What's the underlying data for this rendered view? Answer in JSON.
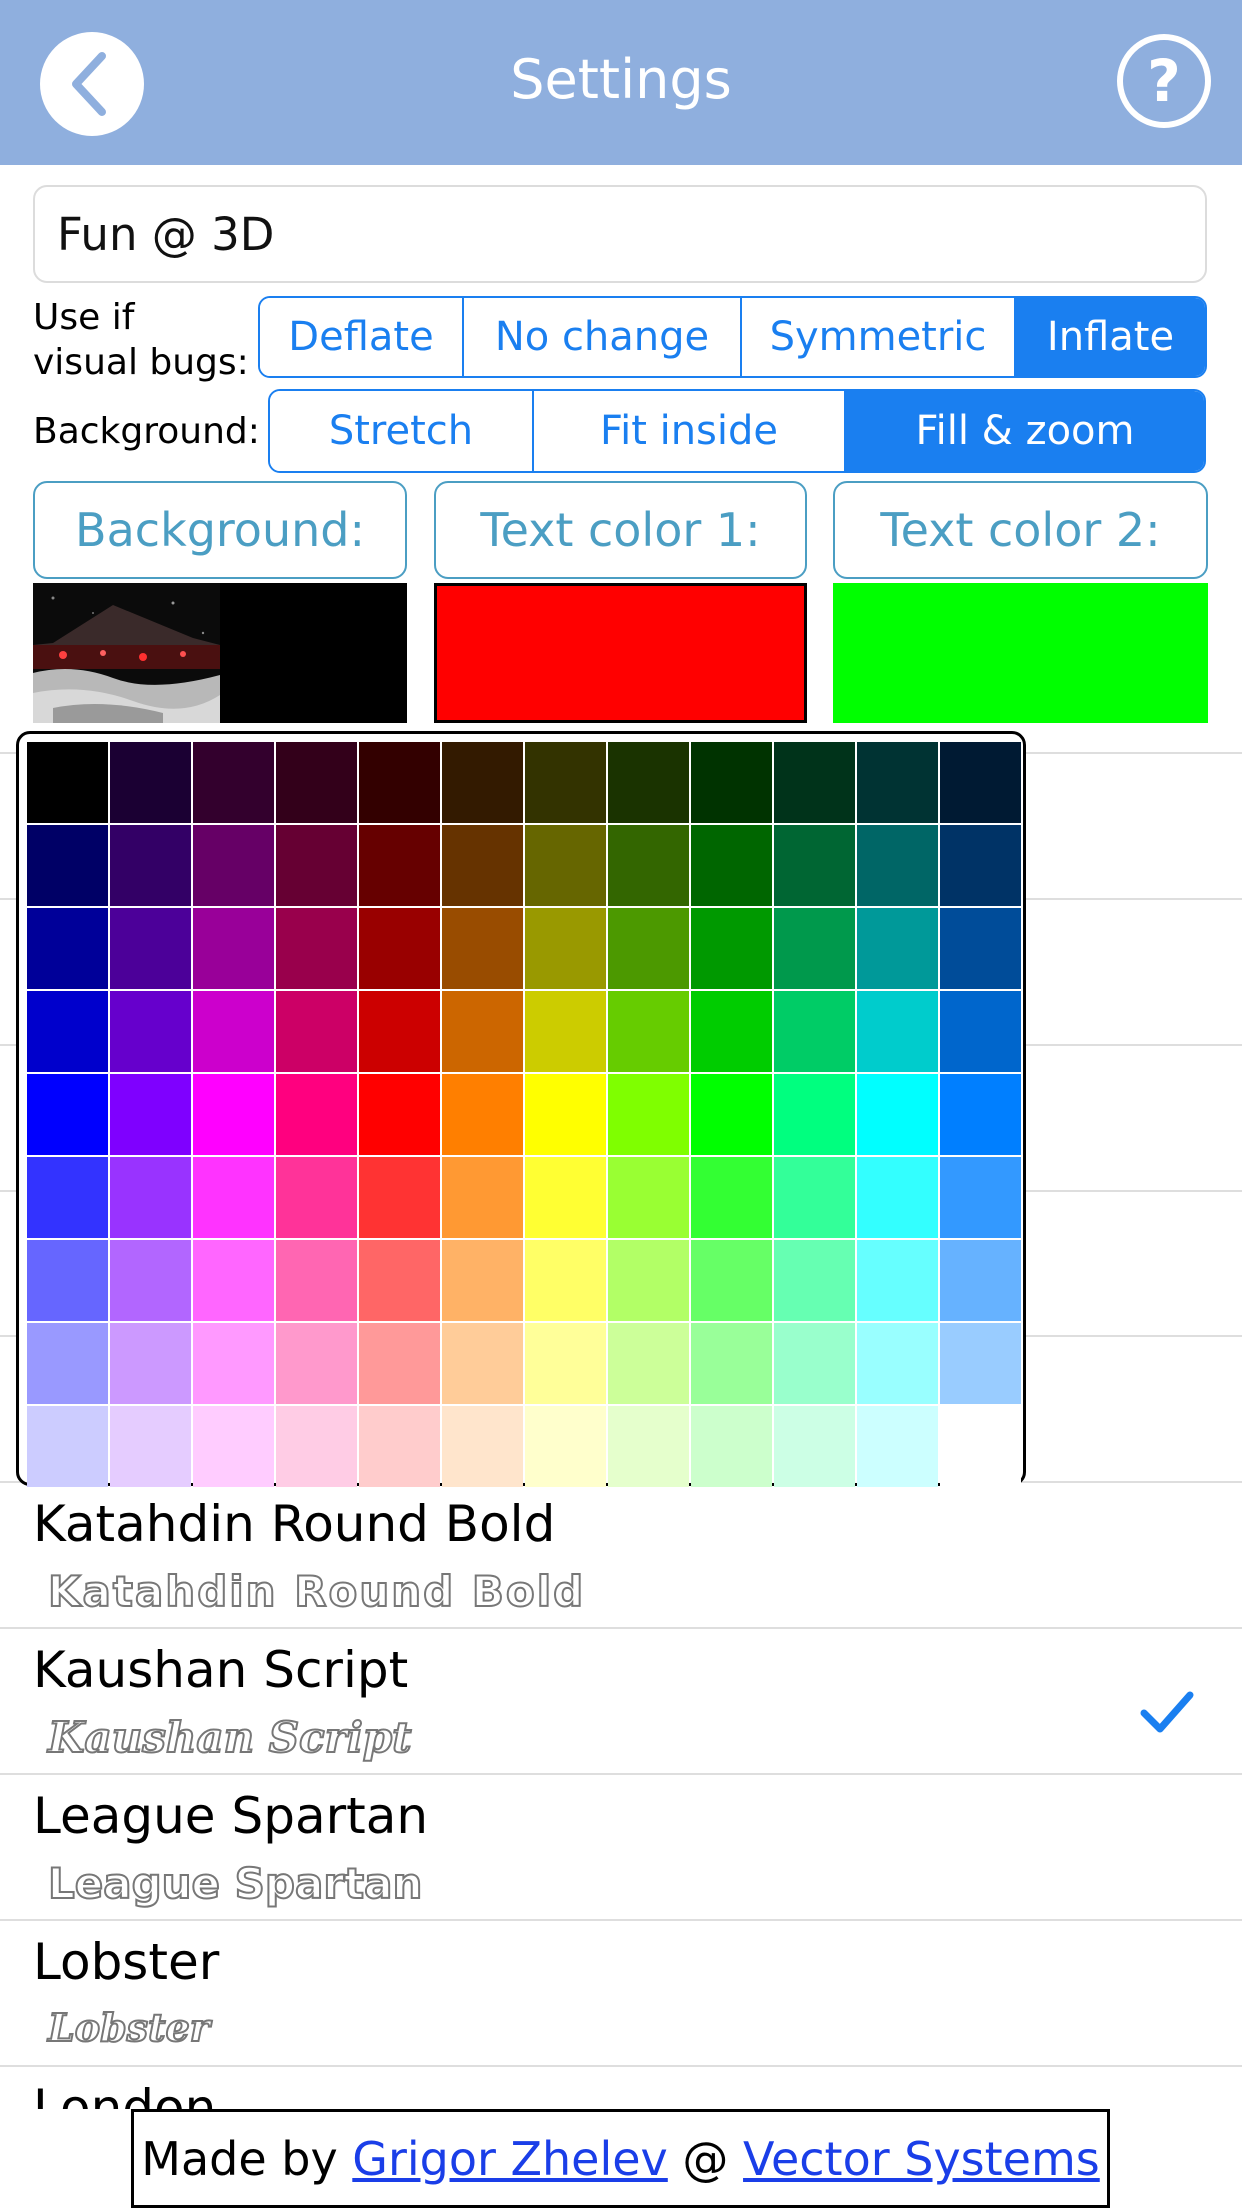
{
  "nav": {
    "title": "Settings",
    "back_icon": "chevron-left-icon",
    "help_icon": "question-mark-icon",
    "color": "#8fafde"
  },
  "name_field": {
    "value": "Fun @ 3D"
  },
  "visual_bugs": {
    "label_line1": "Use if",
    "label_line2": "visual bugs:",
    "options": [
      "Deflate",
      "No change",
      "Symmetric",
      "Inflate"
    ],
    "selected": "Inflate"
  },
  "background_mode": {
    "label": "Background:",
    "options": [
      "Stretch",
      "Fit inside",
      "Fill & zoom"
    ],
    "selected": "Fill & zoom"
  },
  "color_buttons": {
    "background": "Background:",
    "text_color_1": "Text color 1:",
    "text_color_2": "Text color 2:"
  },
  "swatches": {
    "background_image_alt": "campfire-scene-thumbnail",
    "text_color_1": "#ff0000",
    "text_color_2": "#00ff00"
  },
  "fonts": [
    {
      "name": "Katahdin Round Bold",
      "sample": "Katahdin Round Bold",
      "selected": false
    },
    {
      "name": "Kaushan Script",
      "sample": "Kaushan Script",
      "selected": true
    },
    {
      "name": "League Spartan",
      "sample": "League Spartan",
      "selected": false
    },
    {
      "name": "Lobster",
      "sample": "Lobster",
      "selected": false
    },
    {
      "name": "London",
      "sample": "",
      "selected": false
    }
  ],
  "footer": {
    "prefix": "Made by",
    "author": "Grigor Zhelev",
    "separator": "@",
    "company": "Vector Systems"
  },
  "palette": [
    [
      "#000000",
      "#1b0033",
      "#33002d",
      "#33001a",
      "#330000",
      "#331a00",
      "#333300",
      "#1a3300",
      "#003300",
      "#00331a",
      "#003333",
      "#001a33"
    ],
    [
      "#000066",
      "#330066",
      "#660066",
      "#660033",
      "#660000",
      "#663300",
      "#666600",
      "#336600",
      "#006600",
      "#006633",
      "#006666",
      "#003366"
    ],
    [
      "#000099",
      "#4c0099",
      "#990099",
      "#99004c",
      "#990000",
      "#994c00",
      "#999900",
      "#4c9900",
      "#009900",
      "#00994c",
      "#009999",
      "#004c99"
    ],
    [
      "#0000cc",
      "#6600cc",
      "#cc00cc",
      "#cc0066",
      "#cc0000",
      "#cc6600",
      "#cccc00",
      "#66cc00",
      "#00cc00",
      "#00cc66",
      "#00cccc",
      "#0066cc"
    ],
    [
      "#0000ff",
      "#7f00ff",
      "#ff00ff",
      "#ff007f",
      "#ff0000",
      "#ff7f00",
      "#ffff00",
      "#7fff00",
      "#00ff00",
      "#00ff7f",
      "#00ffff",
      "#007fff"
    ],
    [
      "#3333ff",
      "#9933ff",
      "#ff33ff",
      "#ff3399",
      "#ff3333",
      "#ff9933",
      "#ffff33",
      "#99ff33",
      "#33ff33",
      "#33ff99",
      "#33ffff",
      "#3399ff"
    ],
    [
      "#6666ff",
      "#b266ff",
      "#ff66ff",
      "#ff66b2",
      "#ff6666",
      "#ffb266",
      "#ffff66",
      "#b2ff66",
      "#66ff66",
      "#66ffb2",
      "#66ffff",
      "#66b2ff"
    ],
    [
      "#9999ff",
      "#cc99ff",
      "#ff99ff",
      "#ff99cc",
      "#ff9999",
      "#ffcc99",
      "#ffff99",
      "#ccff99",
      "#99ff99",
      "#99ffcc",
      "#99ffff",
      "#99ccff"
    ],
    [
      "#ccccff",
      "#e5ccff",
      "#ffccff",
      "#ffcce5",
      "#ffcccc",
      "#ffe5cc",
      "#ffffcc",
      "#e5ffcc",
      "#ccffcc",
      "#ccffe5",
      "#ccffff",
      "#ffffff"
    ]
  ]
}
